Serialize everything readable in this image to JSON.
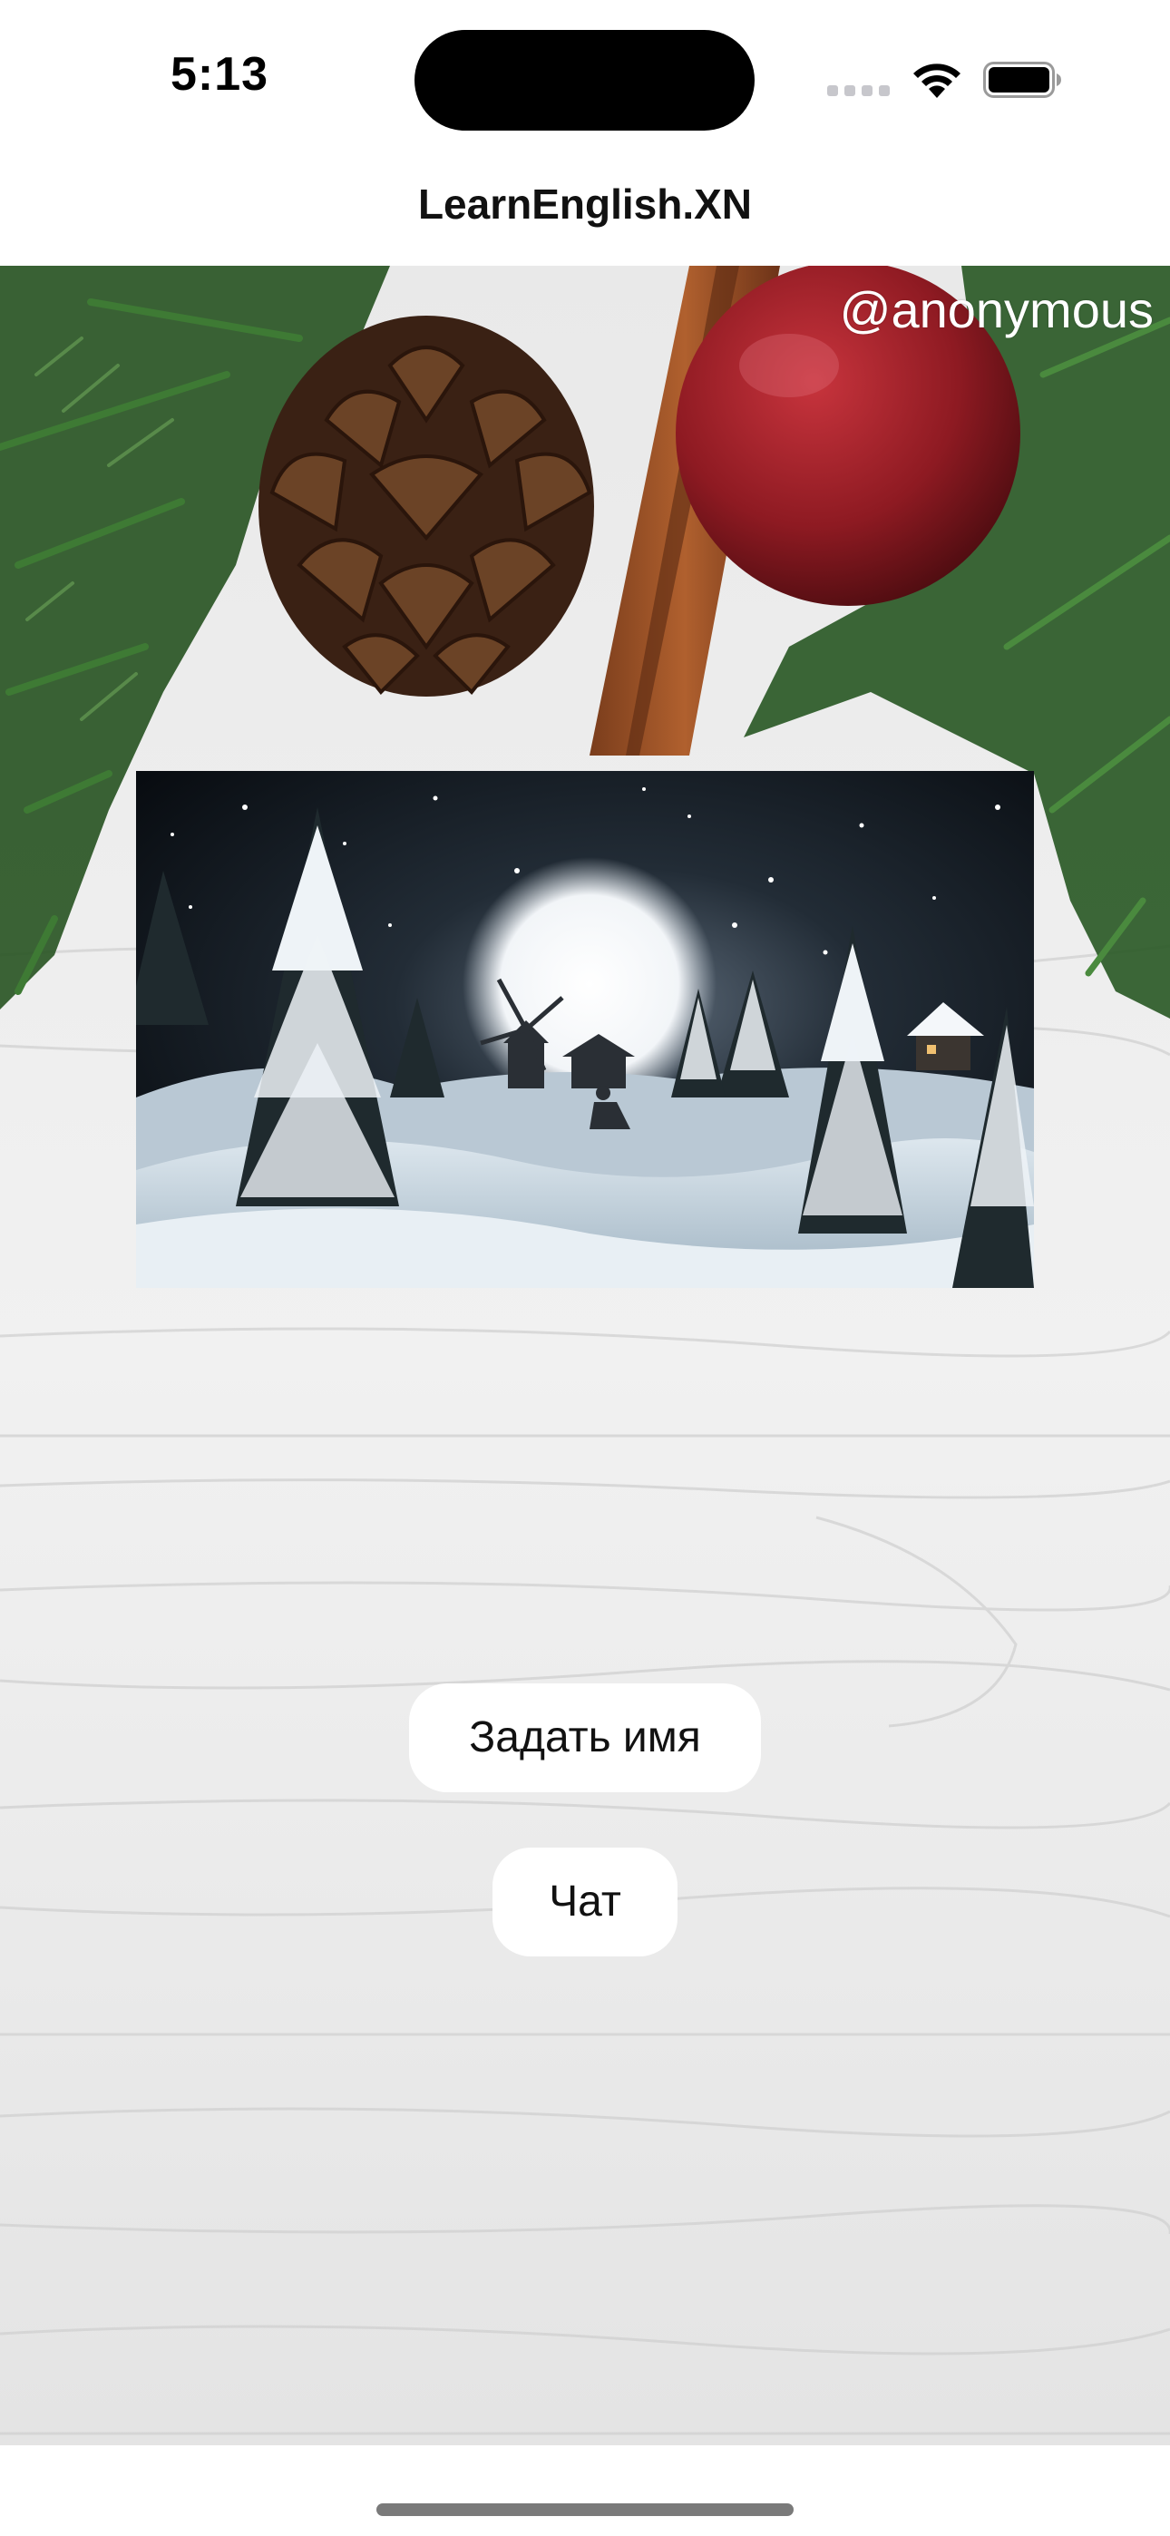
{
  "status_bar": {
    "time": "5:13",
    "icons": [
      "cellular-signal-icon",
      "wifi-icon",
      "battery-icon"
    ]
  },
  "nav": {
    "title": "LearnEnglish.XN"
  },
  "main": {
    "username_label": "@anonymous",
    "image_semantic": "snowy-night-winter-scene",
    "background_semantic": "white-wood-with-christmas-decor",
    "buttons": {
      "set_name": "Задать имя",
      "chat": "Чат"
    }
  },
  "colors": {
    "background": "#ffffff",
    "button_background": "#ffffff",
    "text": "#111111",
    "username_text": "#ffffff"
  }
}
